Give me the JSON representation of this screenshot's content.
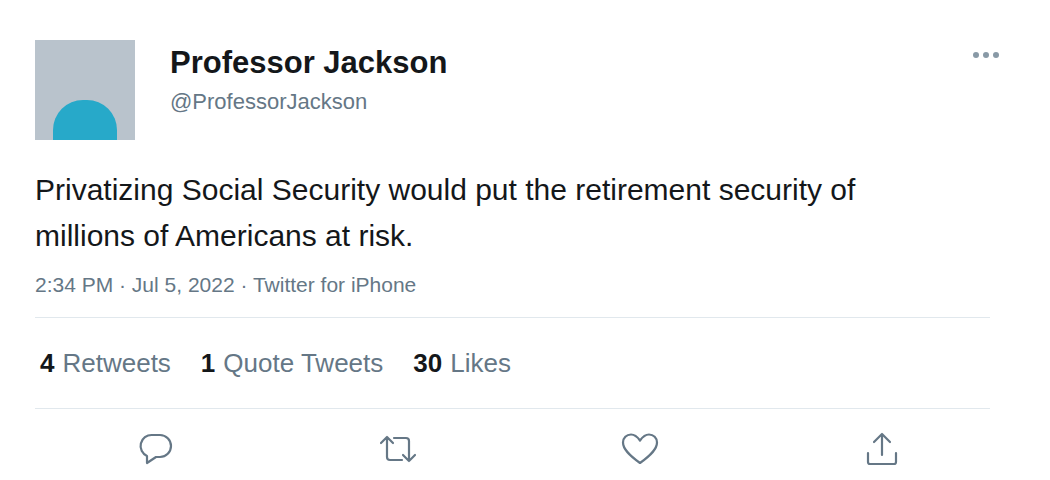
{
  "user": {
    "name": "Professor Jackson",
    "handle": "@ProfessorJackson"
  },
  "tweet": {
    "text": "Privatizing Social Security would put the retirement security of millions of Americans at risk.",
    "timestamp": "2:34 PM · Jul 5, 2022 · Twitter for iPhone"
  },
  "stats": [
    {
      "count": "4",
      "label": "Retweets"
    },
    {
      "count": "1",
      "label": "Quote Tweets"
    },
    {
      "count": "30",
      "label": "Likes"
    }
  ]
}
